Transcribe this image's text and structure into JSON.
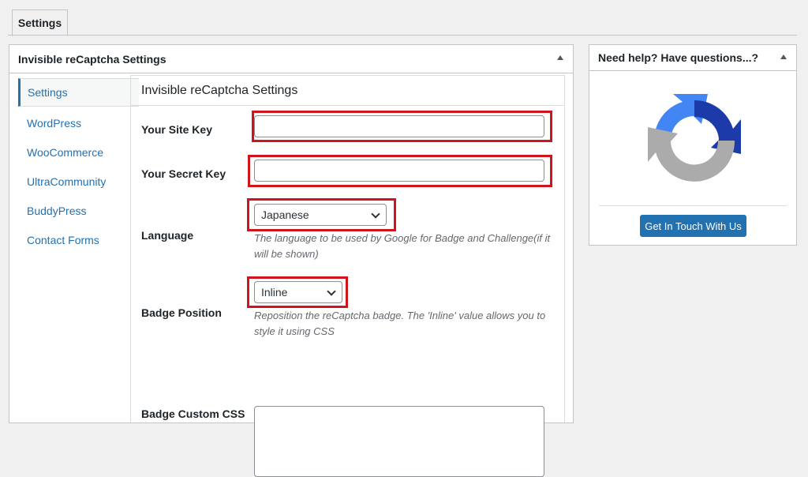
{
  "tabs": [
    {
      "label": "Settings"
    }
  ],
  "main": {
    "title": "Invisible reCaptcha Settings",
    "nav": [
      {
        "label": "Settings"
      },
      {
        "label": "WordPress"
      },
      {
        "label": "WooCommerce"
      },
      {
        "label": "UltraCommunity"
      },
      {
        "label": "BuddyPress"
      },
      {
        "label": "Contact Forms"
      }
    ],
    "section_title": "Invisible reCaptcha Settings",
    "fields": {
      "site_key": {
        "label": "Your Site Key",
        "value": ""
      },
      "secret_key": {
        "label": "Your Secret Key",
        "value": ""
      },
      "language": {
        "label": "Language",
        "selected": "Japanese",
        "description": "The language to be used by Google for Badge and Challenge(if it will be shown)"
      },
      "badge_position": {
        "label": "Badge Position",
        "selected": "Inline",
        "description": "Reposition the reCaptcha badge. The 'Inline' value allows you to style it using CSS"
      },
      "badge_css": {
        "label": "Badge Custom CSS",
        "value": ""
      }
    }
  },
  "help": {
    "title": "Need help? Have questions...?",
    "button_label": "Get In Touch With Us",
    "logo_icon": "recaptcha-logo-icon"
  },
  "colors": {
    "accent": "#2271b1",
    "highlight": "#d0141b",
    "logo_blue_light": "#4285f4",
    "logo_blue_dark": "#1c3aa9",
    "logo_gray": "#ababab"
  }
}
